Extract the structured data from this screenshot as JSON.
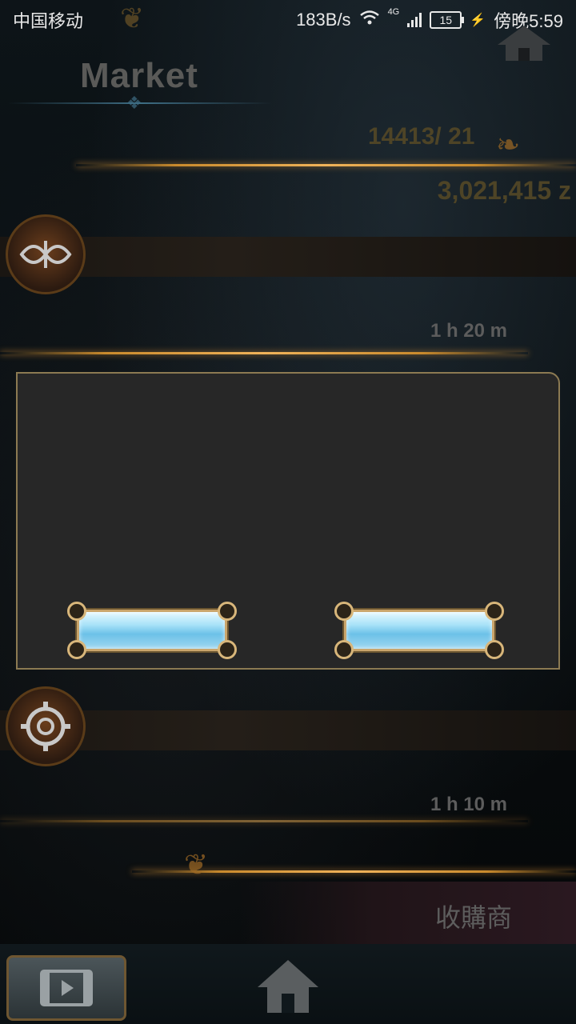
{
  "status_bar": {
    "carrier": "中国移动",
    "speed": "183B/s",
    "network": "4G",
    "battery": "15",
    "time": "傍晚5:59"
  },
  "header": {
    "title": "Market",
    "stock": "14413/ 21",
    "money": "3,021,415 z"
  },
  "rows": [
    {
      "icon": "emblem-icon",
      "time": "1 h 20 m"
    },
    {
      "icon": "gear-icon",
      "time": "1 h 10 m"
    }
  ],
  "dialog": {
    "buttons": [
      {
        "name": "left-gem-button"
      },
      {
        "name": "right-gem-button"
      }
    ]
  },
  "bottom": {
    "shop_label": "收購商"
  },
  "colors": {
    "gold": "#f0b35a",
    "dialog_bg": "#272727",
    "button_gem": "#a8e2f8"
  }
}
